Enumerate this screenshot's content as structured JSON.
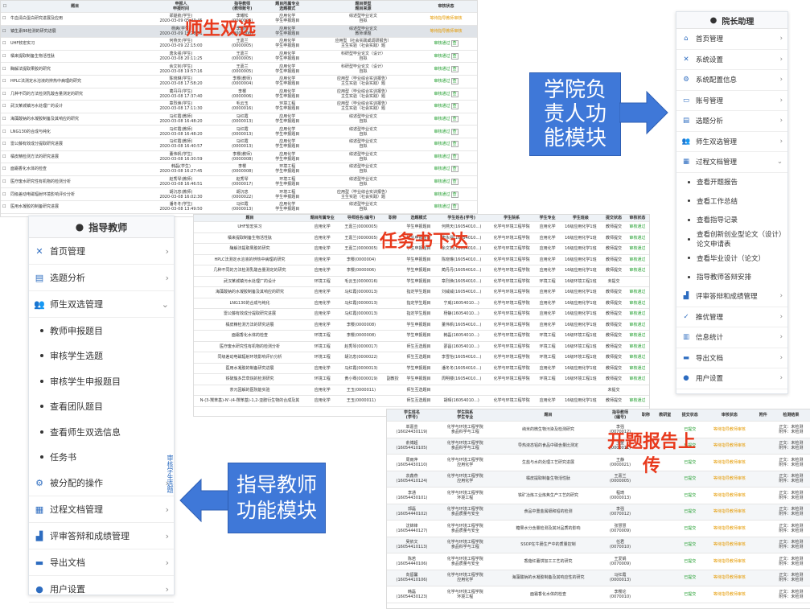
{
  "top_table": {
    "header": [
      "",
      "题目",
      "申报人\n申报时间",
      "指导教师\n(教师账号)",
      "题目所属专业\n选题模式",
      "题目类型\n题目来源",
      "审核状态"
    ],
    "rows": [
      [
        "牛血清白蛋白研究进展及应用",
        "郑楚航(学生)\n2020-03-09 05:43:45",
        "李耀松\n(0000006)",
        "应用化学\n学生申报题目",
        "综述型毕业论文\n自拟",
        "等待指导教师审核"
      ],
      [
        "镇生素B6检测的研究进展",
        "杨爽(学生)\n2020-03-09 15:28:51",
        "李耀松\n(0000006)",
        "应用化学\n学生申报题目",
        "综述型毕业论文\n教师课题",
        "等待指导教师审核"
      ],
      [
        "UHF软宏实习",
        "何燕天(学生)\n2020-03-09 22:15:00",
        "王嘉兰\n(0000005)",
        "应用化学\n学生申报题目",
        "应用型（社会实践或调研报告）\n主生实验（社会实践）题",
        "审核通过"
      ],
      [
        "橘来提取制备生物活性肽",
        "唐永强(学生)\n2020-03-08 20:11:25",
        "王嘉兰\n(0000005)",
        "应用化学\n学生申报题目",
        "科研型毕业论文（设计）\n自拟",
        "审核通过"
      ],
      [
        "酶解法提取果胶的研究",
        "余文钊(学生)\n2020-03-08 19:57:16",
        "王嘉兰\n(0000005)",
        "应用化学\n学生申报题目",
        "科研型毕业论文（设计）\n自拟",
        "审核通过"
      ],
      [
        "HPLC法测定水溶液的辨热中病理的研究",
        "陈晓琳(学生)\n2020-03-08 17:58:20",
        "李樱(教师)\n(0000004)",
        "应用化学\n学生申报题目",
        "应用型（毕业综合实训报告）\n主生实验（社会实践）题",
        "审核通过"
      ],
      [
        "几种不同的方法检测乳酸含量测定的研究",
        "蔺丹丹(学生)\n2020-03-08 17:37:40",
        "李樱\n(0000006)",
        "应用化学\n学生申报题目",
        "应用型（毕业综合实训报告）\n主生实验（社会实践）题",
        "审核通过"
      ],
      [
        "武汉某城镇污水处理厂的设计",
        "章烈焕(学生)\n2020-03-08 17:11:30",
        "毛云玉\n(0000016)",
        "环境工程\n学生申报题目",
        "应用型（毕业综合实训报告）\n主生实验（社会实践）题",
        "审核通过"
      ],
      [
        "海藻酸钠的水凝胶制备及其响应的研究",
        "马红霞(教师)\n2020-03-08 16:48:20",
        "马红霞\n(0000013)",
        "应用化学\n学生申报题目",
        "综述型毕业论文\n自拟",
        "审核通过"
      ],
      [
        "LNG130的合成与纯化",
        "马红霞(教师)\n2020-03-08 16:48:20",
        "马红霞\n(0000013)",
        "应用化学\n学生申报题目",
        "综述型毕业论文\n自拟",
        "审核通过"
      ],
      [
        "雷公藤有效成分提取研究进展",
        "马红霞(教师)\n2020-03-08 16:40:57",
        "马红霞\n(0000013)",
        "应用化学\n学生申报题目",
        "综述型毕业论文\n自拟",
        "审核通过"
      ],
      [
        "橘皮精检测方法的研究进展",
        "董伟帆(学生)\n2020-03-08 16:30:59",
        "李樱(教师)\n(0000008)",
        "应用化学\n学生申报题目",
        "综述型毕业论文\n自拟",
        "审核通过"
      ],
      [
        "面霜香化水体的检查",
        "韩磊(学生)\n2020-03-08 16:27:45",
        "李樱\n(0000008)",
        "环境工程\n学生申报题目",
        "综述型毕业论文\n自拟",
        "审核通过"
      ],
      [
        "医疗废水研究性有机物的检测分析",
        "赵秀琴(教师)\n2020-03-08 16:46:51",
        "赵秀琴\n(0000017)",
        "环境工程\n学生申报题目",
        "综述型毕业论文\n自拟",
        "审核通过"
      ],
      [
        "同级差动电磁辐射环境影响评价分析",
        "胡沉忠(教师)\n2020-03-08 16:02:30",
        "胡沉忠\n(0000022)",
        "环境工程\n学生申报题目",
        "应用型（毕业综合实训报告）\n主生实验（社会实践）题",
        "审核通过"
      ],
      [
        "医用水凝胶的制备研究进展",
        "潘冬冬(学生)\n2020-03-08 13:49:50",
        "马红霞\n(0000013)",
        "应用化学\n学生申报题目",
        "综述型毕业论文\n自拟",
        "审核通过"
      ]
    ],
    "btn_label": "查"
  },
  "mid_table": {
    "header": [
      "题目",
      "题目所属专业",
      "导师姓名(编号)",
      "职称",
      "选题模式",
      "学生姓名(学号)",
      "学生院系",
      "学生专业",
      "学生班级",
      "提交状态",
      "审核状态"
    ],
    "rows": [
      [
        "UHF软宏实习",
        "应用化学",
        "王嘉兰(0000005)",
        "",
        "学生申报题目",
        "何燕天(16054010…)",
        "化学与环境工程学院",
        "应用化学",
        "16级应用化学1班",
        "教师提交",
        "审核通过"
      ],
      [
        "橘来提取制备生物活性肽",
        "应用化学",
        "王嘉兰(0000005)",
        "",
        "学生申报题目",
        "唐永强(16054010…)",
        "化学与环境工程学院",
        "应用化学",
        "16级应用化学1班",
        "教师提交",
        "审核通过"
      ],
      [
        "酶解法提取果胶的研究",
        "应用化学",
        "王嘉兰(0000005)",
        "",
        "学生申报题目",
        "余文钊(16054010…)",
        "化学与环境工程学院",
        "应用化学",
        "16级应用化学1班",
        "教师提交",
        "审核通过"
      ],
      [
        "HPLC法测定水溶液的辨热中病理的研究",
        "应用化学",
        "李樱(0000004)",
        "",
        "学生申报题目",
        "陈晓琳(16054010…)",
        "化学与环境工程学院",
        "应用化学",
        "16级应用化学1班",
        "教师提交",
        "审核通过"
      ],
      [
        "几种不同的方法检测乳酸含量测定的研究",
        "应用化学",
        "李樱(0000006)",
        "",
        "学生申报题目",
        "蔺丹丹(16054010…)",
        "化学与环境工程学院",
        "应用化学",
        "16级应用化学1班",
        "教师提交",
        "审核通过"
      ],
      [
        "武汉某城镇污水处理厂的设计",
        "环境工程",
        "毛云玉(0000016)",
        "",
        "学生申报题目",
        "章烈焕(16054010…)",
        "化学与环境工程学院",
        "环境工程",
        "16级环境工程1班",
        "未提交",
        ""
      ],
      [
        "海藻酸钠的水凝胶制备及其响应的研究",
        "应用化学",
        "马红霞(0000013)",
        "",
        "指定学生题目",
        "刘威威(16054010…)",
        "化学与环境工程学院",
        "应用化学",
        "16级应用化学1班",
        "教师提交",
        "审核通过"
      ],
      [
        "LNG130的合成与纯化",
        "应用化学",
        "马红霞(0000013)",
        "",
        "指定学生题目",
        "宁威(16054010…)",
        "化学与环境工程学院",
        "应用化学",
        "16级应用化学1班",
        "教师提交",
        "审核通过"
      ],
      [
        "雷公藤有效成分提取研究进展",
        "应用化学",
        "马红霞(0000013)",
        "",
        "指定学生题目",
        "杨静(16054010…)",
        "化学与环境工程学院",
        "应用化学",
        "16级应用化学1班",
        "教师提交",
        "审核通过"
      ],
      [
        "橘皮精检测方法的研究进展",
        "应用化学",
        "李樱(0000008)",
        "",
        "学生申报题目",
        "董伟帆(16054010…)",
        "化学与环境工程学院",
        "应用化学",
        "16级应用化学1班",
        "教师提交",
        "审核通过"
      ],
      [
        "面霜香化水体的检查",
        "环境工程",
        "李樱(0000008)",
        "",
        "学生申报题目",
        "韩磊(16054010…)",
        "化学与环境工程学院",
        "环境工程",
        "16级环境工程1班",
        "教师提交",
        "审核通过"
      ],
      [
        "医疗废水研究性有机物的检测分析",
        "环境工程",
        "赵秀琴(0000017)",
        "",
        "师生互选题目",
        "邵昌(16054010…)",
        "化学与环境工程学院",
        "环境工程",
        "16级环境工程1班",
        "教师提交",
        "审核通过"
      ],
      [
        "同级差动电磁辐射环境影响评价分析",
        "环境工程",
        "胡沉忠(0000022)",
        "",
        "师生互选题目",
        "李雪怡(16054010…)",
        "化学与环境工程学院",
        "环境工程",
        "16级环境工程1班",
        "教师提交",
        "审核通过"
      ],
      [
        "医用水凝胶的制备研究进展",
        "应用化学",
        "马红霞(0000013)",
        "",
        "学生申报题目",
        "潘冬冬(16054010…)",
        "化学与环境工程学院",
        "应用化学",
        "16级应用化学1班",
        "教师提交",
        "审核通过"
      ],
      [
        "铁硫簇多异草烷的检测研究",
        "环境工程",
        "黄小骞(0000019)",
        "副教授",
        "学生申报题目",
        "周明楼(16054010…)",
        "化学与环境工程学院",
        "环境工程",
        "16级环境工程1班",
        "教师提交",
        "审核通过"
      ],
      [
        "茶元因解的医院能实验",
        "应用化学",
        "王玉(0000011)",
        "",
        "师生互选题目",
        "",
        "",
        "",
        "",
        "未提交",
        ""
      ],
      [
        "N-(3-羰苯基)-N'-(4-羰苯基)-1,2-亚胺衍生物的合成及其",
        "应用化学",
        "王玉(0000011)",
        "",
        "师生互选题目",
        "胡晴(16054010…)",
        "化学与环境工程学院",
        "应用化学",
        "16级应用化学1班",
        "教师提交",
        "审核通过"
      ]
    ]
  },
  "bottom_table": {
    "header": [
      "学生姓名\n(学号)",
      "学生院系\n学生专业",
      "题目",
      "指导教师\n(编号)",
      "职称",
      "教研室",
      "提交状态",
      "审核状态",
      "附件",
      "检测结果"
    ],
    "rows": [
      [
        "单嘉芸\n(16024430119)",
        "化学与环境工程学院\n食品科学与工程",
        "纳米的微生物污染及检测研究",
        "李强\n(0070012)",
        "",
        "",
        "已提交",
        "等待指导教师审核",
        "正文：未检测\n附件：未检测"
      ],
      [
        "俞博超\n(16054410105)",
        "化学与环境工程学院\n食品科学与工程",
        "导热液态铝的食品中磷含量比测定",
        "王金\n(0000011)",
        "",
        "",
        "已提交",
        "等待指导教师审核",
        "正文：未检测\n附件：未检测"
      ],
      [
        "周雨萍\n(16054430110)",
        "化学与环境工程学院\n应用化学",
        "生盐与水的处理工艺研究进展",
        "王静\n(0000021)",
        "",
        "",
        "已提交",
        "等待指导教师审核",
        "正文：未检测\n附件：未检测"
      ],
      [
        "袁鑫燕\n(16054410124)",
        "化学与环境工程学院\n应用化学",
        "橘皮提取制备生物活性肽",
        "王嘉兰\n(0000005)",
        "",
        "",
        "已提交",
        "等待指导教师审核",
        "正文：未检测\n附件：未检测"
      ],
      [
        "李通\n(16054430101)",
        "化学与环境工程学院\n环境工程",
        "铁矿冶炼工业炼焦生产工艺的研究",
        "程琦\n(0000013)",
        "",
        "",
        "已提交",
        "等待指导教师审核",
        "正文：未检测\n附件：未检测"
      ],
      [
        "郭磊\n(16054440102)",
        "化学与环境工程学院\n食品质量与安全",
        "食品中重金属镉和铅的检测",
        "李强\n(0070012)",
        "",
        "",
        "已提交",
        "等待指导教师审核",
        "正文：未检测\n附件：未检测"
      ],
      [
        "沈锦锋\n(16054440127)",
        "化学与环境工程学院\n食品质量与安全",
        "糖果水分含量检测及其对品质的影响",
        "张慧慧\n(0070009)",
        "",
        "",
        "已提交",
        "等待指导教师审核",
        "正文：未检测\n附件：未检测"
      ],
      [
        "吴依文\n(16054410113)",
        "化学与环境工程学院\n食品科学与工程",
        "SSOP在牛肠生产中的质量控制",
        "任君\n(0070010)",
        "",
        "",
        "已提交",
        "等待指导教师审核",
        "正文：未检测\n附件：未检测"
      ],
      [
        "陈若\n(16054440106)",
        "化学与环境工程学院\n食品质量与安全",
        "香菇红薯饼加工工艺的研究",
        "王爱娟\n(0070009)",
        "",
        "",
        "已提交",
        "等待指导教师审核",
        "正文：未检测\n附件：未检测"
      ],
      [
        "向留馨\n(16054410106)",
        "化学与环境工程学院\n应用化学",
        "海藻酸钠的水凝胶制备及其响应性的研究",
        "马红霞\n(0000013)",
        "",
        "",
        "已提交",
        "等待指导教师审核",
        "正文：未检测\n附件：未检测"
      ],
      [
        "韩磊\n(16054430123)",
        "化学与环境工程学院\n环境工程",
        "面霜香化水体的检查",
        "李樱论\n(0070010)",
        "",
        "",
        "已提交",
        "等待指导教师审核",
        "正文：未检测\n附件：未检测"
      ]
    ]
  },
  "annotations": {
    "shisheng_shuangxuan": "师生双选",
    "renwushu_xiada": "任务书下达",
    "kaiti_baogao": "开题报告上传",
    "college_callout": "学院负责人功能模块",
    "teacher_callout": "指导教师功能模块"
  },
  "college_sidebar": {
    "title": "院长助理",
    "items": [
      {
        "icon": "home-icon",
        "glyph": "⌂",
        "label": "首页管理",
        "chev": "›"
      },
      {
        "icon": "tools-icon",
        "glyph": "✕",
        "label": "系统设置",
        "chev": "›"
      },
      {
        "icon": "gear-icon",
        "glyph": "⚙",
        "label": "系统配置信息",
        "chev": "›"
      },
      {
        "icon": "monitor-icon",
        "glyph": "▭",
        "label": "账号管理",
        "chev": "›"
      },
      {
        "icon": "chart-icon",
        "glyph": "▤",
        "label": "选题分析",
        "chev": "›"
      },
      {
        "icon": "users-icon",
        "glyph": "👥",
        "label": "师生双选管理",
        "chev": "›"
      },
      {
        "icon": "book-icon",
        "glyph": "▦",
        "label": "过程文档管理",
        "chev": "⌄"
      }
    ],
    "subitems": [
      "查看开题报告",
      "查看工作总结",
      "查看指导记录",
      "查看创新创业型论文（设计）论文申请表",
      "查看毕业设计（论文）",
      "指导教师答辩安排"
    ],
    "items_after": [
      {
        "icon": "bar-chart-icon",
        "glyph": "▟",
        "label": "评审答辩和成绩管理",
        "chev": "›"
      },
      {
        "icon": "thumb-icon",
        "glyph": "✓",
        "label": "推优管理",
        "chev": "›"
      },
      {
        "icon": "stats-icon",
        "glyph": "▥",
        "label": "信息统计",
        "chev": "›"
      },
      {
        "icon": "folder-icon",
        "glyph": "▬",
        "label": "导出文档",
        "chev": "›"
      },
      {
        "icon": "user-icon",
        "glyph": "●",
        "label": "用户设置",
        "chev": "›"
      }
    ]
  },
  "teacher_sidebar": {
    "title": "指导教师",
    "items": [
      {
        "icon": "tools-icon",
        "glyph": "✕",
        "label": "首页管理",
        "chev": "›"
      },
      {
        "icon": "chart-icon",
        "glyph": "▤",
        "label": "选题分析",
        "chev": "›"
      },
      {
        "icon": "users-icon",
        "glyph": "👥",
        "label": "师生双选管理",
        "chev": "⌄"
      }
    ],
    "subitems": [
      "教师申报题目",
      "审核学生选题",
      "审核学生申报题目",
      "查看团队题目",
      "查看师生双选信息",
      "任务书"
    ],
    "items_after": [
      {
        "icon": "gear-icon",
        "glyph": "⚙",
        "label": "被分配的操作",
        "chev": "›"
      },
      {
        "icon": "book-icon",
        "glyph": "▦",
        "label": "过程文档管理",
        "chev": "›"
      },
      {
        "icon": "bar-chart-icon",
        "glyph": "▟",
        "label": "评审答辩和成绩管理",
        "chev": "›"
      },
      {
        "icon": "folder-icon",
        "glyph": "▬",
        "label": "导出文档",
        "chev": "›"
      },
      {
        "icon": "user-icon",
        "glyph": "●",
        "label": "用户设置",
        "chev": "›"
      }
    ],
    "side_tab": "审核学生选题"
  },
  "colors": {
    "red_annotation": "#e8391c",
    "callout_blue": "#3f78d8",
    "icon_blue": "#2d6cc0",
    "status_orange": "#e59a00",
    "status_green": "#1f9d2c"
  }
}
